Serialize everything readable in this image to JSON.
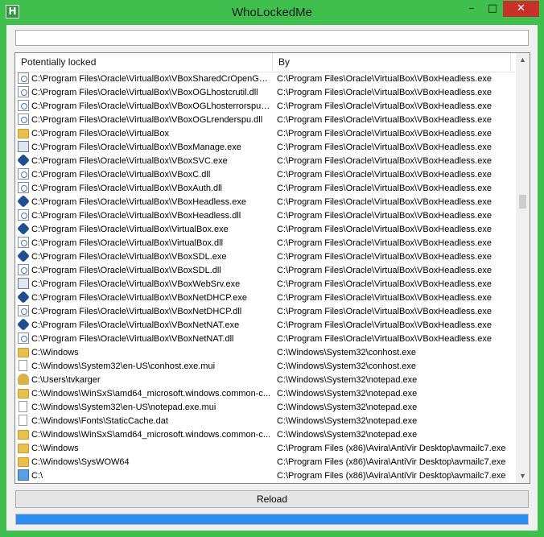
{
  "window": {
    "title": "WhoLockedMe",
    "icon_letter": "H"
  },
  "search": {
    "value": ""
  },
  "list": {
    "columns": [
      "Potentially locked",
      "By"
    ],
    "rows": [
      {
        "icon": "dll",
        "path": "C:\\Program Files\\Oracle\\VirtualBox\\VBoxSharedCrOpenGL.dll",
        "by": "C:\\Program Files\\Oracle\\VirtualBox\\VBoxHeadless.exe"
      },
      {
        "icon": "dll",
        "path": "C:\\Program Files\\Oracle\\VirtualBox\\VBoxOGLhostcrutil.dll",
        "by": "C:\\Program Files\\Oracle\\VirtualBox\\VBoxHeadless.exe"
      },
      {
        "icon": "dll",
        "path": "C:\\Program Files\\Oracle\\VirtualBox\\VBoxOGLhosterrorspu.dll",
        "by": "C:\\Program Files\\Oracle\\VirtualBox\\VBoxHeadless.exe"
      },
      {
        "icon": "dll",
        "path": "C:\\Program Files\\Oracle\\VirtualBox\\VBoxOGLrenderspu.dll",
        "by": "C:\\Program Files\\Oracle\\VirtualBox\\VBoxHeadless.exe"
      },
      {
        "icon": "folder",
        "path": "C:\\Program Files\\Oracle\\VirtualBox",
        "by": "C:\\Program Files\\Oracle\\VirtualBox\\VBoxHeadless.exe"
      },
      {
        "icon": "exe",
        "path": "C:\\Program Files\\Oracle\\VirtualBox\\VBoxManage.exe",
        "by": "C:\\Program Files\\Oracle\\VirtualBox\\VBoxHeadless.exe"
      },
      {
        "icon": "vbox",
        "path": "C:\\Program Files\\Oracle\\VirtualBox\\VBoxSVC.exe",
        "by": "C:\\Program Files\\Oracle\\VirtualBox\\VBoxHeadless.exe"
      },
      {
        "icon": "dll",
        "path": "C:\\Program Files\\Oracle\\VirtualBox\\VBoxC.dll",
        "by": "C:\\Program Files\\Oracle\\VirtualBox\\VBoxHeadless.exe"
      },
      {
        "icon": "dll",
        "path": "C:\\Program Files\\Oracle\\VirtualBox\\VBoxAuth.dll",
        "by": "C:\\Program Files\\Oracle\\VirtualBox\\VBoxHeadless.exe"
      },
      {
        "icon": "vbox",
        "path": "C:\\Program Files\\Oracle\\VirtualBox\\VBoxHeadless.exe",
        "by": "C:\\Program Files\\Oracle\\VirtualBox\\VBoxHeadless.exe"
      },
      {
        "icon": "dll",
        "path": "C:\\Program Files\\Oracle\\VirtualBox\\VBoxHeadless.dll",
        "by": "C:\\Program Files\\Oracle\\VirtualBox\\VBoxHeadless.exe"
      },
      {
        "icon": "vbox",
        "path": "C:\\Program Files\\Oracle\\VirtualBox\\VirtualBox.exe",
        "by": "C:\\Program Files\\Oracle\\VirtualBox\\VBoxHeadless.exe"
      },
      {
        "icon": "dll",
        "path": "C:\\Program Files\\Oracle\\VirtualBox\\VirtualBox.dll",
        "by": "C:\\Program Files\\Oracle\\VirtualBox\\VBoxHeadless.exe"
      },
      {
        "icon": "vbox",
        "path": "C:\\Program Files\\Oracle\\VirtualBox\\VBoxSDL.exe",
        "by": "C:\\Program Files\\Oracle\\VirtualBox\\VBoxHeadless.exe"
      },
      {
        "icon": "dll",
        "path": "C:\\Program Files\\Oracle\\VirtualBox\\VBoxSDL.dll",
        "by": "C:\\Program Files\\Oracle\\VirtualBox\\VBoxHeadless.exe"
      },
      {
        "icon": "exe",
        "path": "C:\\Program Files\\Oracle\\VirtualBox\\VBoxWebSrv.exe",
        "by": "C:\\Program Files\\Oracle\\VirtualBox\\VBoxHeadless.exe"
      },
      {
        "icon": "vbox",
        "path": "C:\\Program Files\\Oracle\\VirtualBox\\VBoxNetDHCP.exe",
        "by": "C:\\Program Files\\Oracle\\VirtualBox\\VBoxHeadless.exe"
      },
      {
        "icon": "dll",
        "path": "C:\\Program Files\\Oracle\\VirtualBox\\VBoxNetDHCP.dll",
        "by": "C:\\Program Files\\Oracle\\VirtualBox\\VBoxHeadless.exe"
      },
      {
        "icon": "vbox",
        "path": "C:\\Program Files\\Oracle\\VirtualBox\\VBoxNetNAT.exe",
        "by": "C:\\Program Files\\Oracle\\VirtualBox\\VBoxHeadless.exe"
      },
      {
        "icon": "dll",
        "path": "C:\\Program Files\\Oracle\\VirtualBox\\VBoxNetNAT.dll",
        "by": "C:\\Program Files\\Oracle\\VirtualBox\\VBoxHeadless.exe"
      },
      {
        "icon": "folder",
        "path": "C:\\Windows",
        "by": "C:\\Windows\\System32\\conhost.exe"
      },
      {
        "icon": "file",
        "path": "C:\\Windows\\System32\\en-US\\conhost.exe.mui",
        "by": "C:\\Windows\\System32\\conhost.exe"
      },
      {
        "icon": "user",
        "path": "C:\\Users\\tvkarger",
        "by": "C:\\Windows\\System32\\notepad.exe"
      },
      {
        "icon": "folder",
        "path": "C:\\Windows\\WinSxS\\amd64_microsoft.windows.common-c...",
        "by": "C:\\Windows\\System32\\notepad.exe"
      },
      {
        "icon": "file",
        "path": "C:\\Windows\\System32\\en-US\\notepad.exe.mui",
        "by": "C:\\Windows\\System32\\notepad.exe"
      },
      {
        "icon": "file",
        "path": "C:\\Windows\\Fonts\\StaticCache.dat",
        "by": "C:\\Windows\\System32\\notepad.exe"
      },
      {
        "icon": "folder",
        "path": "C:\\Windows\\WinSxS\\amd64_microsoft.windows.common-c...",
        "by": "C:\\Windows\\System32\\notepad.exe"
      },
      {
        "icon": "folder",
        "path": "C:\\Windows",
        "by": "C:\\Program Files (x86)\\Avira\\AntiVir Desktop\\avmailc7.exe"
      },
      {
        "icon": "folder",
        "path": "C:\\Windows\\SysWOW64",
        "by": "C:\\Program Files (x86)\\Avira\\AntiVir Desktop\\avmailc7.exe"
      },
      {
        "icon": "drive",
        "path": "C:\\",
        "by": "C:\\Program Files (x86)\\Avira\\AntiVir Desktop\\avmailc7.exe"
      }
    ]
  },
  "buttons": {
    "reload": "Reload"
  },
  "progress": {
    "fraction": 1.0
  }
}
